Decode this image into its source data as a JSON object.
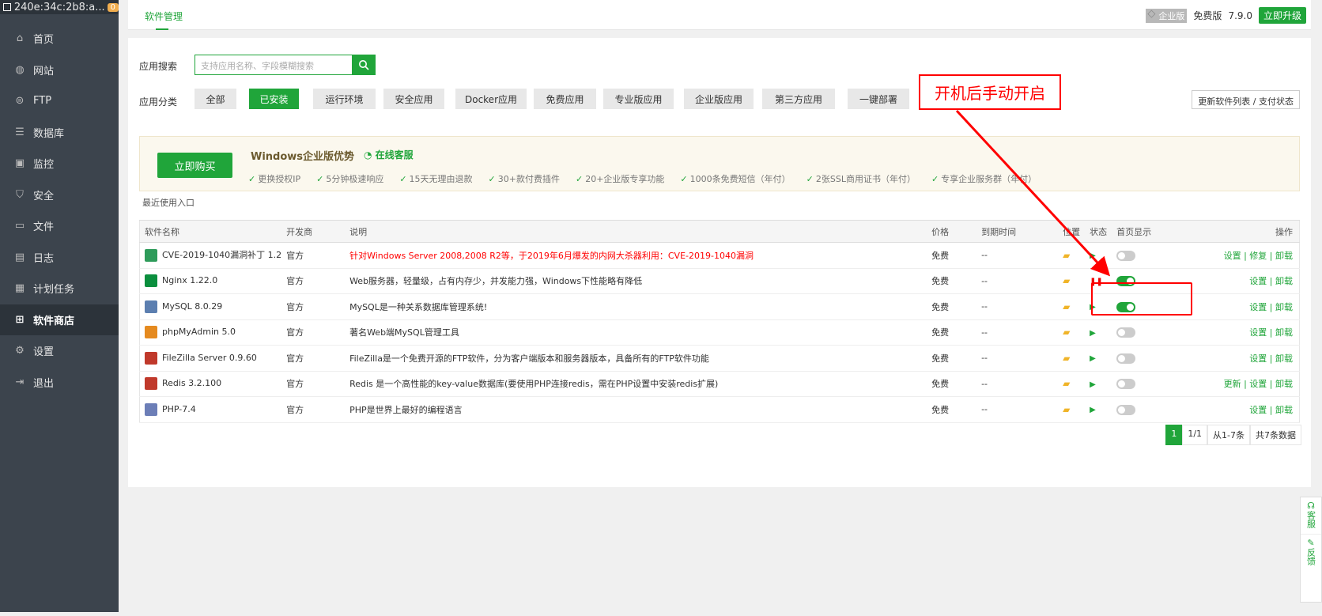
{
  "sidebar": {
    "host": "240e:34c:2b8:a...",
    "badge": "0",
    "items": [
      {
        "label": "首页",
        "icon": "home-icon"
      },
      {
        "label": "网站",
        "icon": "globe-icon"
      },
      {
        "label": "FTP",
        "icon": "ftp-icon"
      },
      {
        "label": "数据库",
        "icon": "database-icon"
      },
      {
        "label": "监控",
        "icon": "monitor-icon"
      },
      {
        "label": "安全",
        "icon": "shield-icon"
      },
      {
        "label": "文件",
        "icon": "folder-icon"
      },
      {
        "label": "日志",
        "icon": "log-icon"
      },
      {
        "label": "计划任务",
        "icon": "calendar-icon"
      },
      {
        "label": "软件商店",
        "icon": "grid-icon"
      },
      {
        "label": "设置",
        "icon": "gear-icon"
      },
      {
        "label": "退出",
        "icon": "logout-icon"
      }
    ]
  },
  "topbar": {
    "tab": "软件管理",
    "enterprise": "企业版",
    "free": "免费版",
    "version": "7.9.0",
    "upgrade": "立即升级"
  },
  "search": {
    "label": "应用搜索",
    "placeholder": "支持应用名称、字段模糊搜索"
  },
  "categories": {
    "label": "应用分类",
    "items": [
      "全部",
      "已安装",
      "运行环境",
      "安全应用",
      "Docker应用",
      "免费应用",
      "专业版应用",
      "企业版应用",
      "第三方应用",
      "一键部署"
    ],
    "refresh": "更新软件列表 / 支付状态"
  },
  "promo": {
    "buy": "立即购买",
    "title": "Windows企业版优势",
    "service": "在线客服",
    "features": [
      "更换授权IP",
      "5分钟极速响应",
      "15天无理由退款",
      "30+款付费插件",
      "20+企业版专享功能",
      "1000条免费短信（年付）",
      "2张SSL商用证书（年付）",
      "专享企业服务群（年付）"
    ]
  },
  "recent": "最近使用入口",
  "table": {
    "headers": [
      "软件名称",
      "开发商",
      "说明",
      "价格",
      "到期时间",
      "位置",
      "状态",
      "首页显示",
      "操作"
    ],
    "rows": [
      {
        "name": "CVE-2019-1040漏洞补丁 1.2",
        "dev": "官方",
        "desc": "针对Windows Server 2008,2008 R2等，于2019年6月爆发的内网大杀器利用：CVE-2019-1040漏洞",
        "price": "免费",
        "expire": "--",
        "ops": "设置 | 修复 | 卸载"
      },
      {
        "name": "Nginx 1.22.0",
        "dev": "官方",
        "desc": "Web服务器，轻量级，占有内存少，并发能力强，Windows下性能略有降低",
        "price": "免费",
        "expire": "--",
        "ops": "设置 | 卸载"
      },
      {
        "name": "MySQL 8.0.29",
        "dev": "官方",
        "desc": "MySQL是一种关系数据库管理系统!",
        "price": "免费",
        "expire": "--",
        "ops": "设置 | 卸载"
      },
      {
        "name": "phpMyAdmin 5.0",
        "dev": "官方",
        "desc": "著名Web端MySQL管理工具",
        "price": "免费",
        "expire": "--",
        "ops": "设置 | 卸载"
      },
      {
        "name": "FileZilla Server 0.9.60",
        "dev": "官方",
        "desc": "FileZilla是一个免费开源的FTP软件，分为客户端版本和服务器版本，具备所有的FTP软件功能",
        "price": "免费",
        "expire": "--",
        "ops": "设置 | 卸载"
      },
      {
        "name": "Redis 3.2.100",
        "dev": "官方",
        "desc": "Redis 是一个高性能的key-value数据库(要使用PHP连接redis，需在PHP设置中安装redis扩展)",
        "price": "免费",
        "expire": "--",
        "ops": "更新 | 设置 | 卸载"
      },
      {
        "name": "PHP-7.4",
        "dev": "官方",
        "desc": "PHP是世界上最好的编程语言",
        "price": "免费",
        "expire": "--",
        "ops": "设置 | 卸载"
      }
    ]
  },
  "pager": {
    "current": "1",
    "pages": "1/1",
    "range": "从1-7条",
    "total": "共7条数据"
  },
  "annotation": "开机后手动开启",
  "float": {
    "service": "客服",
    "feedback": "反馈"
  }
}
